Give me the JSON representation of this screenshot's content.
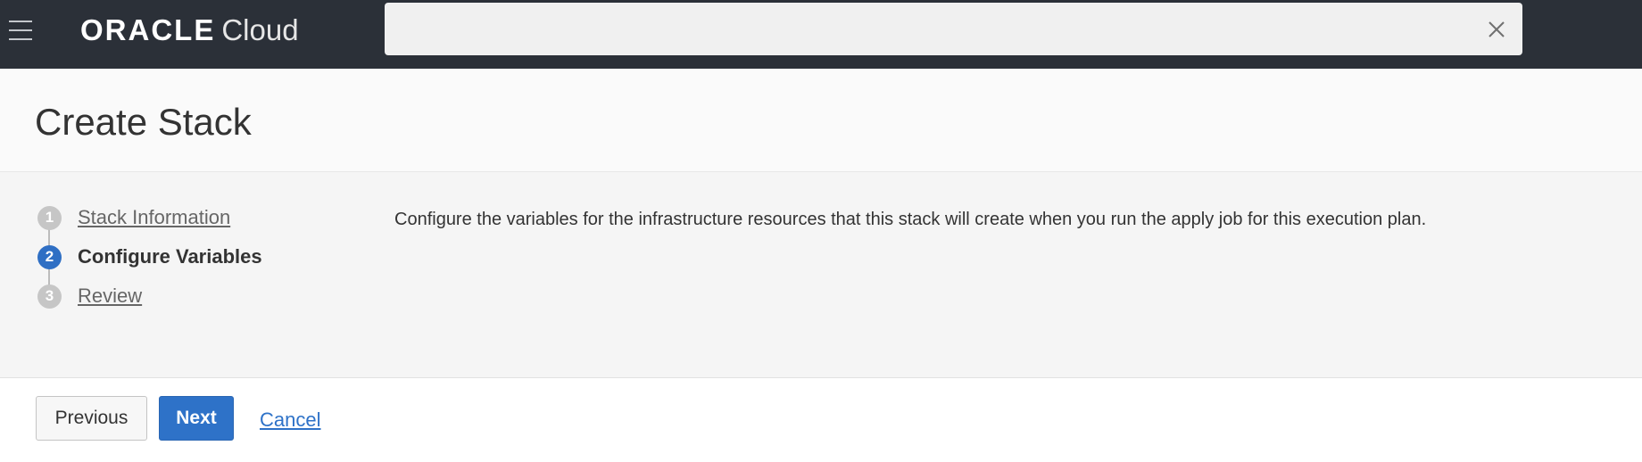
{
  "header": {
    "logo_brand": "ORACLE",
    "logo_product": "Cloud",
    "search": {
      "value": "",
      "placeholder": ""
    },
    "colors": {
      "background": "#2b3038"
    }
  },
  "page": {
    "title": "Create Stack"
  },
  "wizard": {
    "steps": [
      {
        "number": "1",
        "label": "Stack Information",
        "state": "completed"
      },
      {
        "number": "2",
        "label": "Configure Variables",
        "state": "active"
      },
      {
        "number": "3",
        "label": "Review",
        "state": "pending"
      }
    ],
    "description": "Configure the variables for the infrastructure resources that this stack will create when you run the apply job for this execution plan."
  },
  "footer": {
    "previous_label": "Previous",
    "next_label": "Next",
    "cancel_label": "Cancel"
  },
  "colors": {
    "accent": "#2e72c8",
    "step_inactive": "#c6c6c6"
  },
  "icons": {
    "menu": "hamburger-menu-icon",
    "clear": "close-icon"
  }
}
